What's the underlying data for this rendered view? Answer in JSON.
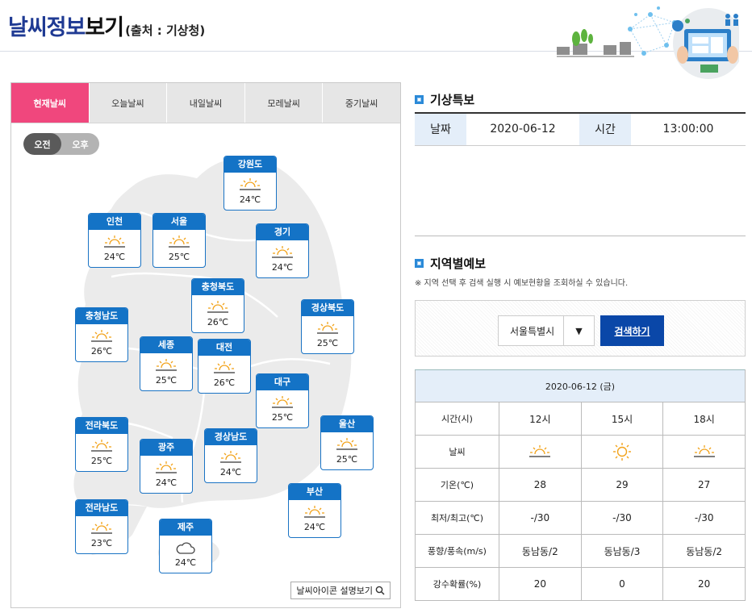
{
  "header": {
    "title_part1": "날씨정보",
    "title_part2": "보기",
    "source": "(출처 : 기상청)"
  },
  "tabs": [
    "현재날씨",
    "오늘날씨",
    "내일날씨",
    "모레날씨",
    "중기날씨"
  ],
  "active_tab": "현재날씨",
  "ampm": [
    "오전",
    "오후"
  ],
  "active_ampm": "오전",
  "regions": [
    {
      "name": "강원도",
      "icon": "sun-icon",
      "temp": "24℃"
    },
    {
      "name": "인천",
      "icon": "sun-icon",
      "temp": "24℃"
    },
    {
      "name": "서울",
      "icon": "sun-icon",
      "temp": "25℃"
    },
    {
      "name": "경기",
      "icon": "sun-icon",
      "temp": "24℃"
    },
    {
      "name": "충청북도",
      "icon": "sun-icon",
      "temp": "26℃"
    },
    {
      "name": "충청남도",
      "icon": "sun-icon",
      "temp": "26℃"
    },
    {
      "name": "경상북도",
      "icon": "sun-icon",
      "temp": "25℃"
    },
    {
      "name": "세종",
      "icon": "sun-icon",
      "temp": "25℃"
    },
    {
      "name": "대전",
      "icon": "sun-icon",
      "temp": "26℃"
    },
    {
      "name": "대구",
      "icon": "sun-icon",
      "temp": "25℃"
    },
    {
      "name": "전라북도",
      "icon": "sun-icon",
      "temp": "25℃"
    },
    {
      "name": "광주",
      "icon": "sun-icon",
      "temp": "24℃"
    },
    {
      "name": "경상남도",
      "icon": "sun-icon",
      "temp": "24℃"
    },
    {
      "name": "울산",
      "icon": "sun-icon",
      "temp": "25℃"
    },
    {
      "name": "부산",
      "icon": "sun-icon",
      "temp": "24℃"
    },
    {
      "name": "전라남도",
      "icon": "sun-icon",
      "temp": "23℃"
    },
    {
      "name": "제주",
      "icon": "cloud-icon",
      "temp": "24℃"
    }
  ],
  "icon_guide_label": "날씨아이콘 설명보기",
  "warning": {
    "title": "기상특보",
    "date_label": "날짜",
    "date_value": "2020-06-12",
    "time_label": "시간",
    "time_value": "13:00:00"
  },
  "regional": {
    "title": "지역별예보",
    "description": "※ 지역 선택 후 검색 실행 시 예보현황을 조회하실 수 있습니다.",
    "selected_region": "서울특별시",
    "search_label": "검색하기",
    "date_header": "2020-06-12 (금)",
    "rows": [
      {
        "label": "시간(시)",
        "values": [
          "12시",
          "15시",
          "18시"
        ]
      },
      {
        "label": "날씨",
        "icons": [
          "sun-icon",
          "sun-icon",
          "sun-icon"
        ]
      },
      {
        "label": "기온(℃)",
        "values": [
          "28",
          "29",
          "27"
        ]
      },
      {
        "label": "최저/최고(℃)",
        "values": [
          "-/30",
          "-/30",
          "-/30"
        ]
      },
      {
        "label": "풍향/풍속(m/s)",
        "values": [
          "동남동/2",
          "동남동/3",
          "동남동/2"
        ]
      },
      {
        "label": "강수확률(%)",
        "values": [
          "20",
          "0",
          "20"
        ]
      }
    ]
  },
  "colors": {
    "active_tab": "#f0477d",
    "region_header": "#1473c6",
    "search_button": "#0a47a8",
    "sun": "#f2a31b"
  }
}
